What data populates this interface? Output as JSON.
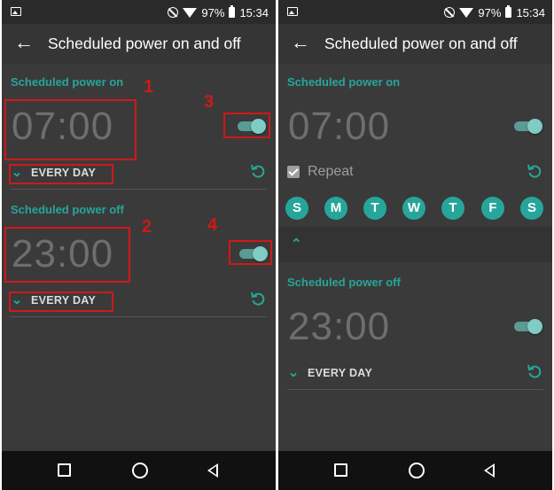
{
  "status_bar": {
    "battery": "97%",
    "time": "15:34"
  },
  "app_bar": {
    "title": "Scheduled power on and off"
  },
  "left": {
    "power_on": {
      "label": "Scheduled power on",
      "time": "07:00",
      "repeat": "EVERY DAY",
      "enabled": true
    },
    "power_off": {
      "label": "Scheduled power off",
      "time": "23:00",
      "repeat": "EVERY DAY",
      "enabled": true
    },
    "annotations": [
      "1",
      "2",
      "3",
      "4"
    ],
    "annotation_color": "#d01818"
  },
  "right": {
    "power_on": {
      "label": "Scheduled power on",
      "time": "07:00",
      "enabled": true,
      "repeat_checkbox_label": "Repeat",
      "repeat_checked": true
    },
    "days": [
      "S",
      "M",
      "T",
      "W",
      "T",
      "F",
      "S"
    ],
    "power_off": {
      "label": "Scheduled power off",
      "time": "23:00",
      "repeat": "EVERY DAY",
      "enabled": true
    }
  },
  "colors": {
    "accent": "#26a69a",
    "background": "#3a3a3a",
    "statusbar": "#2a2a2a"
  },
  "icons": [
    "gallery-icon",
    "dnd-icon",
    "wifi-icon",
    "battery-icon",
    "back-arrow-icon",
    "chevron-down-icon",
    "chevron-up-icon",
    "reset-icon",
    "check-icon",
    "recent-apps-icon",
    "home-icon",
    "back-nav-icon"
  ]
}
